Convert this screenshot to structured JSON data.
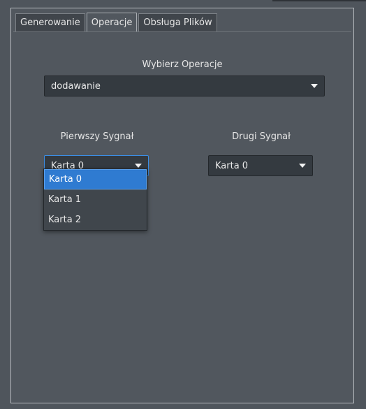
{
  "tabs": [
    {
      "label": "Generowanie",
      "active": false
    },
    {
      "label": "Operacje",
      "active": true
    },
    {
      "label": "Obsługa Plików",
      "active": false
    }
  ],
  "operation": {
    "label": "Wybierz Operacje",
    "selected": "dodawanie"
  },
  "first_signal": {
    "label": "Pierwszy Sygnał",
    "selected": "Karta 0",
    "options": [
      "Karta 0",
      "Karta 1",
      "Karta 2"
    ],
    "highlighted": "Karta 0"
  },
  "second_signal": {
    "label": "Drugi Sygnał",
    "selected": "Karta 0"
  },
  "colors": {
    "accent": "#2f7bd1",
    "background": "#4f555c",
    "combo_bg": "#343a40"
  },
  "icons": {
    "dropdown_arrow": "chevron-down-icon"
  }
}
